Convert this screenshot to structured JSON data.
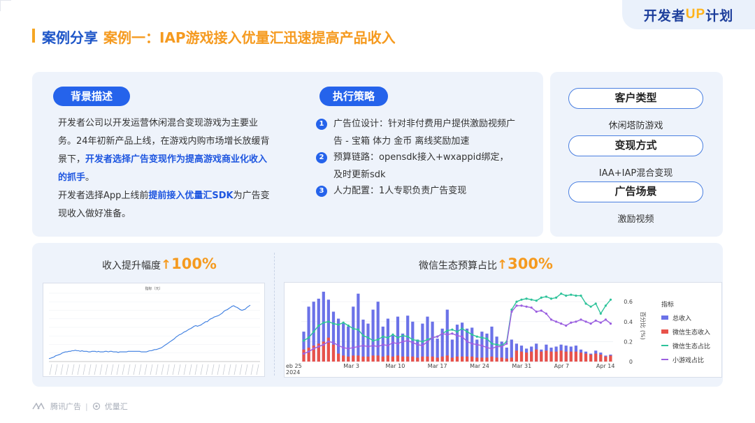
{
  "brand": {
    "pre": "开发者",
    "up": "UP",
    "post": "计划"
  },
  "title": {
    "part1": "案例分享",
    "part2": "案例一：IAP游戏接入优量汇迅速提高产品收入"
  },
  "background": {
    "label": "背景描述",
    "p1_a": "开发者公司以开发运营休闲混合变现游戏为主要业务。24年初新产品上线，在游戏内购市场增长放缓背景下，",
    "p1_hl": "开发者选择广告变现作为提高游戏商业化收入的抓手",
    "p1_b": "。",
    "p2_a": "开发者选择App上线前",
    "p2_hl": "提前接入优量汇SDK",
    "p2_b": "为广告变现收入做好准备。"
  },
  "strategy": {
    "label": "执行策略",
    "steps": [
      {
        "num": "1",
        "text": "广告位设计：针对非付费用户提供激励视频广告 - 宝箱 体力 金币 离线奖励加速"
      },
      {
        "num": "2",
        "text": "预算链路：opensdk接入+wxappid绑定，及时更新sdk"
      },
      {
        "num": "3",
        "text": "人力配置：1人专职负责广告变现"
      }
    ]
  },
  "side": {
    "customer_label": "客户类型",
    "customer_value": "休闲塔防游戏",
    "monetize_label": "变现方式",
    "monetize_value": "IAA+IAP混合变现",
    "scene_label": "广告场景",
    "scene_value": "激励视频"
  },
  "chart_left_header": {
    "label": "收入提升幅度",
    "arrow": "↑",
    "pct": "100%"
  },
  "chart_right_header": {
    "label": "微信生态预算占比",
    "arrow": "↑",
    "pct": "300%"
  },
  "chart_data": [
    {
      "type": "line",
      "title": "指标（元）",
      "series": [
        {
          "values": [
            5,
            6,
            7,
            8,
            10,
            11,
            12,
            13,
            15,
            16,
            17,
            17,
            18,
            18,
            19,
            19,
            20,
            19,
            19,
            18,
            19,
            18,
            18,
            18,
            17,
            17,
            18,
            18,
            18,
            17,
            18,
            17,
            17,
            17,
            18,
            18,
            17,
            18,
            18,
            17,
            17,
            17,
            16,
            17,
            17,
            17,
            17,
            17,
            18,
            18,
            18,
            18,
            18,
            18,
            18,
            18,
            17,
            17,
            17,
            17,
            18,
            19,
            19,
            20,
            21,
            21,
            22,
            23,
            24,
            26,
            28,
            30,
            32,
            34,
            36,
            38,
            40,
            43,
            45,
            47,
            48,
            50,
            52,
            53,
            55,
            57,
            58,
            60,
            62,
            63,
            62,
            63,
            64,
            66,
            68,
            70,
            70,
            73,
            75,
            76,
            78,
            79,
            80,
            81,
            83,
            85,
            88,
            90,
            91,
            93,
            95,
            97,
            98,
            96,
            95,
            93,
            91,
            90,
            91,
            92,
            95,
            97,
            99
          ]
        }
      ],
      "ylim": [
        0,
        120
      ],
      "grid": true
    },
    {
      "type": "bar+line",
      "xtick_labels": [
        "eb 25\n2024",
        "Mar 3",
        "Mar 10",
        "Mar 17",
        "Mar 24",
        "Mar 31",
        "Apr 7",
        "Apr 14"
      ],
      "y2label": "百分比 (%)",
      "y2ticks": [
        "0",
        "0.2",
        "0.4",
        "0.6"
      ],
      "legend_title": "指标",
      "series": [
        {
          "name": "总收入",
          "kind": "bar",
          "color": "#6b72e8",
          "values": [
            0.3,
            0.55,
            0.6,
            0.63,
            0.7,
            0.62,
            0.5,
            0.43,
            0.38,
            0.35,
            0.55,
            0.68,
            0.42,
            0.38,
            0.52,
            0.6,
            0.35,
            0.43,
            0.26,
            0.45,
            0.28,
            0.46,
            0.4,
            0.22,
            0.38,
            0.45,
            0.4,
            0.23,
            0.33,
            0.52,
            0.22,
            0.37,
            0.39,
            0.33,
            0.34,
            0.22,
            0.3,
            0.28,
            0.35,
            0.25,
            0.2,
            0.14,
            0.22,
            0.18,
            0.16,
            0.13,
            0.15,
            0.18,
            0.12,
            0.17,
            0.14,
            0.15,
            0.17,
            0.16,
            0.15,
            0.16,
            0.12,
            0.1,
            0.08,
            0.11,
            0.09,
            0.06,
            0.07
          ]
        },
        {
          "name": "微信生态收入",
          "kind": "bar",
          "color": "#e8524a",
          "values": [
            0.12,
            0.14,
            0.16,
            0.18,
            0.2,
            0.24,
            0.17,
            0.08,
            0.06,
            0.05,
            0.06,
            0.06,
            0.05,
            0.05,
            0.06,
            0.06,
            0.05,
            0.06,
            0.05,
            0.06,
            0.05,
            0.05,
            0.05,
            0.04,
            0.05,
            0.05,
            0.05,
            0.04,
            0.05,
            0.06,
            0.04,
            0.05,
            0.05,
            0.05,
            0.05,
            0.04,
            0.04,
            0.04,
            0.05,
            0.04,
            0.04,
            0.03,
            0.04,
            0.11,
            0.1,
            0.09,
            0.1,
            0.12,
            0.1,
            0.11,
            0.1,
            0.1,
            0.11,
            0.1,
            0.1,
            0.1,
            0.09,
            0.08,
            0.07,
            0.08,
            0.07,
            0.05,
            0.06
          ]
        },
        {
          "name": "微信生态占比",
          "kind": "line",
          "color": "#2ec39a",
          "values": [
            0.21,
            0.24,
            0.3,
            0.36,
            0.39,
            0.4,
            0.38,
            0.37,
            0.39,
            0.36,
            0.33,
            0.32,
            0.26,
            0.24,
            0.21,
            0.22,
            0.25,
            0.24,
            0.27,
            0.24,
            0.26,
            0.25,
            0.22,
            0.21,
            0.2,
            0.22,
            0.24,
            0.25,
            0.28,
            0.31,
            0.32,
            0.3,
            0.33,
            0.3,
            0.27,
            0.25,
            0.24,
            0.23,
            0.18,
            0.17,
            0.16,
            0.2,
            0.52,
            0.6,
            0.62,
            0.63,
            0.62,
            0.61,
            0.64,
            0.65,
            0.63,
            0.64,
            0.68,
            0.66,
            0.67,
            0.66,
            0.66,
            0.58,
            0.55,
            0.58,
            0.48,
            0.56,
            0.62
          ]
        },
        {
          "name": "小游戏占比",
          "kind": "line",
          "color": "#9b5fe0",
          "values": [
            0.08,
            0.1,
            0.13,
            0.15,
            0.17,
            0.2,
            0.19,
            0.16,
            0.14,
            0.13,
            0.14,
            0.15,
            0.16,
            0.15,
            0.16,
            0.15,
            0.17,
            0.16,
            0.19,
            0.18,
            0.2,
            0.21,
            0.19,
            0.17,
            0.16,
            0.2,
            0.24,
            0.25,
            0.28,
            0.27,
            0.28,
            0.26,
            0.25,
            0.2,
            0.18,
            0.17,
            0.16,
            0.14,
            0.13,
            0.15,
            0.15,
            0.18,
            0.5,
            0.56,
            0.56,
            0.55,
            0.54,
            0.5,
            0.51,
            0.48,
            0.42,
            0.4,
            0.38,
            0.36,
            0.39,
            0.4,
            0.42,
            0.4,
            0.38,
            0.41,
            0.39,
            0.42,
            0.38
          ]
        }
      ],
      "ylim": [
        0,
        0.72
      ],
      "grid": true
    }
  ],
  "footer": {
    "tencent": "腾讯广告",
    "ylh": "优量汇"
  }
}
